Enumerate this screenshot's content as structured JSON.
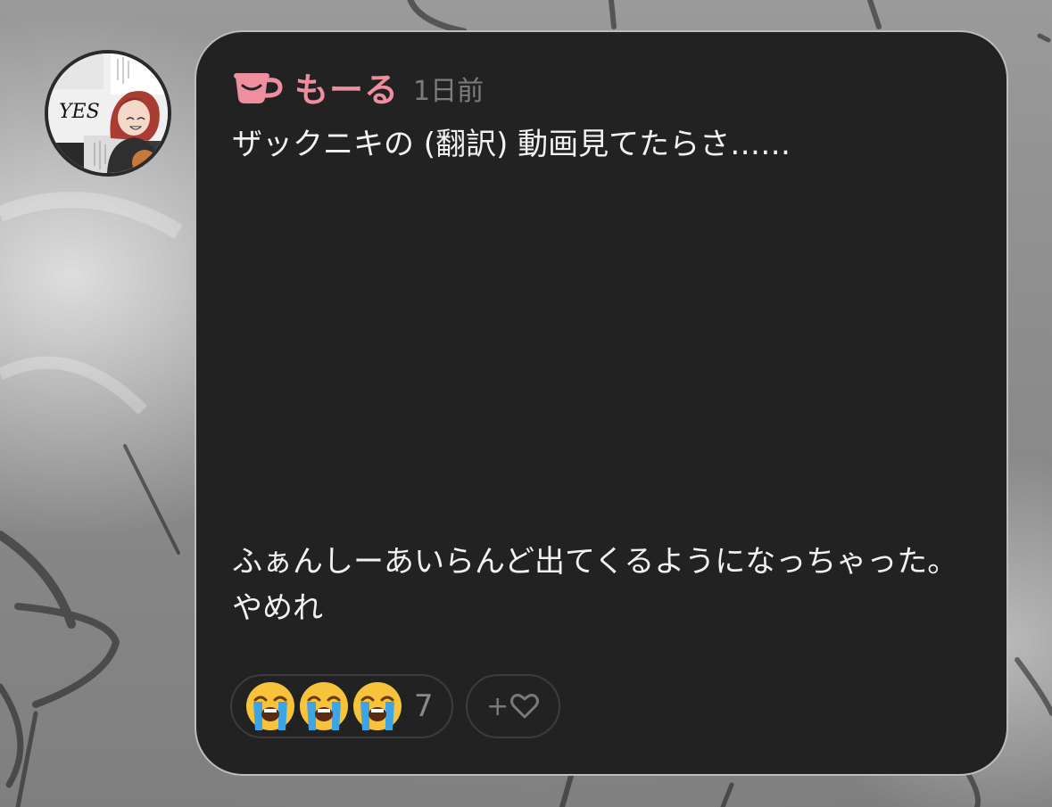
{
  "post": {
    "username": "もーる",
    "timestamp": "1日前",
    "message": "ザックニキの (翻訳) 動画見てたらさ……\n\n\n\n\n\n\n\n\nふぁんしーあいらんど出てくるようになっちゃった。やめれ",
    "avatar_caption": "YES",
    "accent_color": "#ee8e9f"
  },
  "reactions": {
    "emojis": [
      "loudly-crying-face",
      "loudly-crying-face",
      "loudly-crying-face"
    ],
    "count": "7",
    "add_label": "+"
  },
  "icons": {
    "username_badge": "coffee-cup-icon",
    "add_reaction": "heart-outline-icon"
  }
}
